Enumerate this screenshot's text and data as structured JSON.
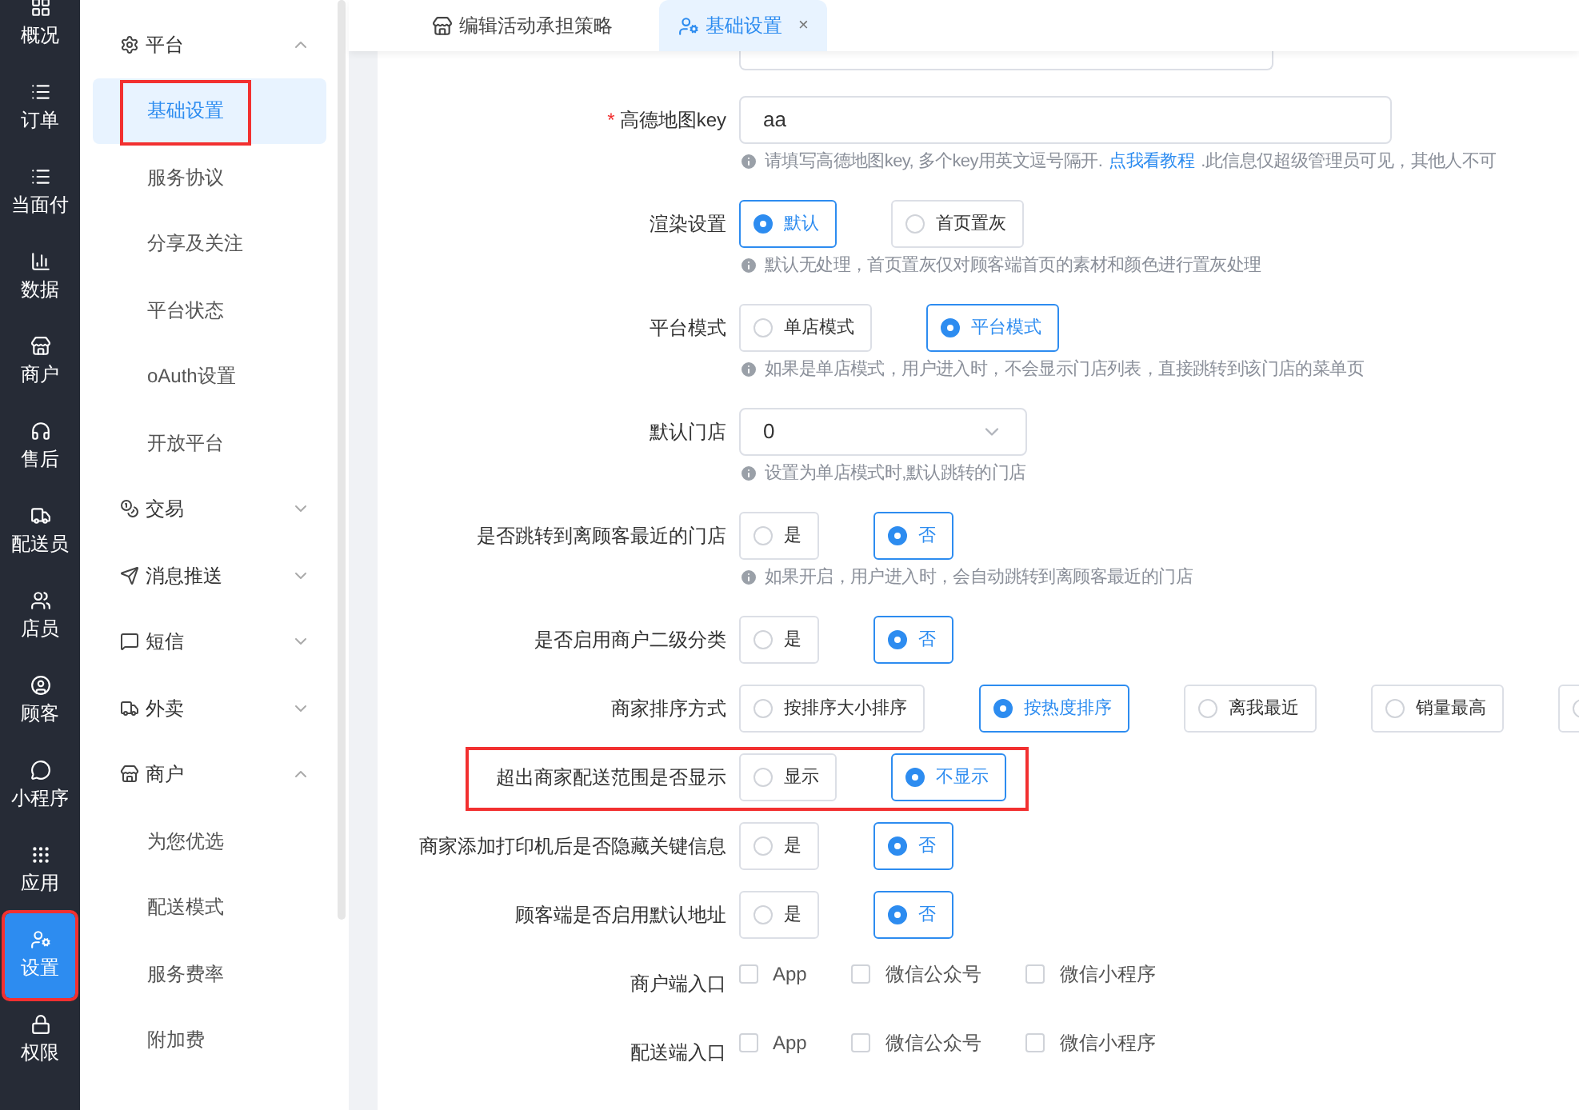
{
  "nav": [
    {
      "label": "概况",
      "selected": false,
      "highlighted": false
    },
    {
      "label": "订单",
      "selected": false,
      "highlighted": false
    },
    {
      "label": "当面付",
      "selected": false,
      "highlighted": false
    },
    {
      "label": "数据",
      "selected": false,
      "highlighted": false
    },
    {
      "label": "商户",
      "selected": false,
      "highlighted": false
    },
    {
      "label": "售后",
      "selected": false,
      "highlighted": false
    },
    {
      "label": "配送员",
      "selected": false,
      "highlighted": false
    },
    {
      "label": "店员",
      "selected": false,
      "highlighted": false
    },
    {
      "label": "顾客",
      "selected": false,
      "highlighted": false
    },
    {
      "label": "小程序",
      "selected": false,
      "highlighted": false
    },
    {
      "label": "应用",
      "selected": false,
      "highlighted": false
    },
    {
      "label": "设置",
      "selected": true,
      "highlighted": true
    },
    {
      "label": "权限",
      "selected": false,
      "highlighted": false
    }
  ],
  "menu": [
    {
      "label": "平台",
      "expanded": true,
      "children": [
        {
          "label": "基础设置",
          "selected": true,
          "highlighted": true
        },
        {
          "label": "服务协议",
          "selected": false,
          "highlighted": false
        },
        {
          "label": "分享及关注",
          "selected": false,
          "highlighted": false
        },
        {
          "label": "平台状态",
          "selected": false,
          "highlighted": false
        },
        {
          "label": "oAuth设置",
          "selected": false,
          "highlighted": false
        },
        {
          "label": "开放平台",
          "selected": false,
          "highlighted": false
        }
      ]
    },
    {
      "label": "交易",
      "expanded": false
    },
    {
      "label": "消息推送",
      "expanded": false
    },
    {
      "label": "短信",
      "expanded": false
    },
    {
      "label": "外卖",
      "expanded": false
    },
    {
      "label": "商户",
      "expanded": true,
      "children": [
        {
          "label": "为您优选",
          "selected": false,
          "highlighted": false
        },
        {
          "label": "配送模式",
          "selected": false,
          "highlighted": false
        },
        {
          "label": "服务费率",
          "selected": false,
          "highlighted": false
        },
        {
          "label": "附加费",
          "selected": false,
          "highlighted": false
        }
      ]
    }
  ],
  "tabs": [
    {
      "label": "编辑活动承担策略",
      "selected": false
    },
    {
      "label": "基础设置",
      "selected": true,
      "close": "×"
    }
  ],
  "form": [
    {
      "kind": "input",
      "label": "高德地图key",
      "required_mark": "*",
      "value": "aa",
      "highlighted": false,
      "hint": [
        {
          "kind": "text",
          "text": "请填写高德地图key, 多个key用英文逗号隔开. "
        },
        {
          "kind": "link",
          "text": "点我看教程"
        },
        {
          "kind": "text",
          "text": ".此信息仅超级管理员可见，其他人不可"
        }
      ]
    },
    {
      "kind": "radio",
      "label": "渲染设置",
      "highlighted": false,
      "options": [
        {
          "label": "默认",
          "selected": true
        },
        {
          "label": "首页置灰",
          "selected": false
        }
      ],
      "hint": [
        {
          "kind": "text",
          "text": "默认无处理，首页置灰仅对顾客端首页的素材和颜色进行置灰处理"
        }
      ]
    },
    {
      "kind": "radio",
      "label": "平台模式",
      "highlighted": false,
      "options": [
        {
          "label": "单店模式",
          "selected": false
        },
        {
          "label": "平台模式",
          "selected": true
        }
      ],
      "hint": [
        {
          "kind": "text",
          "text": "如果是单店模式，用户进入时，不会显示门店列表，直接跳转到该门店的菜单页"
        }
      ]
    },
    {
      "kind": "select",
      "label": "默认门店",
      "highlighted": false,
      "value": "0",
      "hint": [
        {
          "kind": "text",
          "text": "设置为单店模式时,默认跳转的门店"
        }
      ]
    },
    {
      "kind": "radio",
      "label": "是否跳转到离顾客最近的门店",
      "highlighted": false,
      "options": [
        {
          "label": "是",
          "selected": false
        },
        {
          "label": "否",
          "selected": true
        }
      ],
      "hint": [
        {
          "kind": "text",
          "text": "如果开启，用户进入时，会自动跳转到离顾客最近的门店"
        }
      ]
    },
    {
      "kind": "radio",
      "label": "是否启用商户二级分类",
      "highlighted": false,
      "options": [
        {
          "label": "是",
          "selected": false
        },
        {
          "label": "否",
          "selected": true
        }
      ]
    },
    {
      "kind": "radio",
      "label": "商家排序方式",
      "highlighted": false,
      "options": [
        {
          "label": "按排序大小排序",
          "selected": false
        },
        {
          "label": "按热度排序",
          "selected": true
        },
        {
          "label": "离我最近",
          "selected": false
        },
        {
          "label": "销量最高",
          "selected": false
        },
        {
          "selected": false
        }
      ]
    },
    {
      "kind": "radio",
      "label": "超出商家配送范围是否显示",
      "highlighted": true,
      "options": [
        {
          "label": "显示",
          "selected": false
        },
        {
          "label": "不显示",
          "selected": true
        }
      ]
    },
    {
      "kind": "radio",
      "label": "商家添加打印机后是否隐藏关键信息",
      "highlighted": false,
      "options": [
        {
          "label": "是",
          "selected": false
        },
        {
          "label": "否",
          "selected": true
        }
      ]
    },
    {
      "kind": "radio",
      "label": "顾客端是否启用默认地址",
      "highlighted": false,
      "options": [
        {
          "label": "是",
          "selected": false
        },
        {
          "label": "否",
          "selected": true
        }
      ]
    },
    {
      "kind": "checkbox",
      "label": "商户端入口",
      "highlighted": false,
      "options": [
        {
          "label": "App",
          "checked": false
        },
        {
          "label": "微信公众号",
          "checked": false
        },
        {
          "label": "微信小程序",
          "checked": false
        }
      ]
    },
    {
      "kind": "checkbox",
      "label": "配送端入口",
      "highlighted": false,
      "options": [
        {
          "label": "App",
          "checked": false
        },
        {
          "label": "微信公众号",
          "checked": false
        },
        {
          "label": "微信小程序",
          "checked": false
        }
      ]
    }
  ]
}
